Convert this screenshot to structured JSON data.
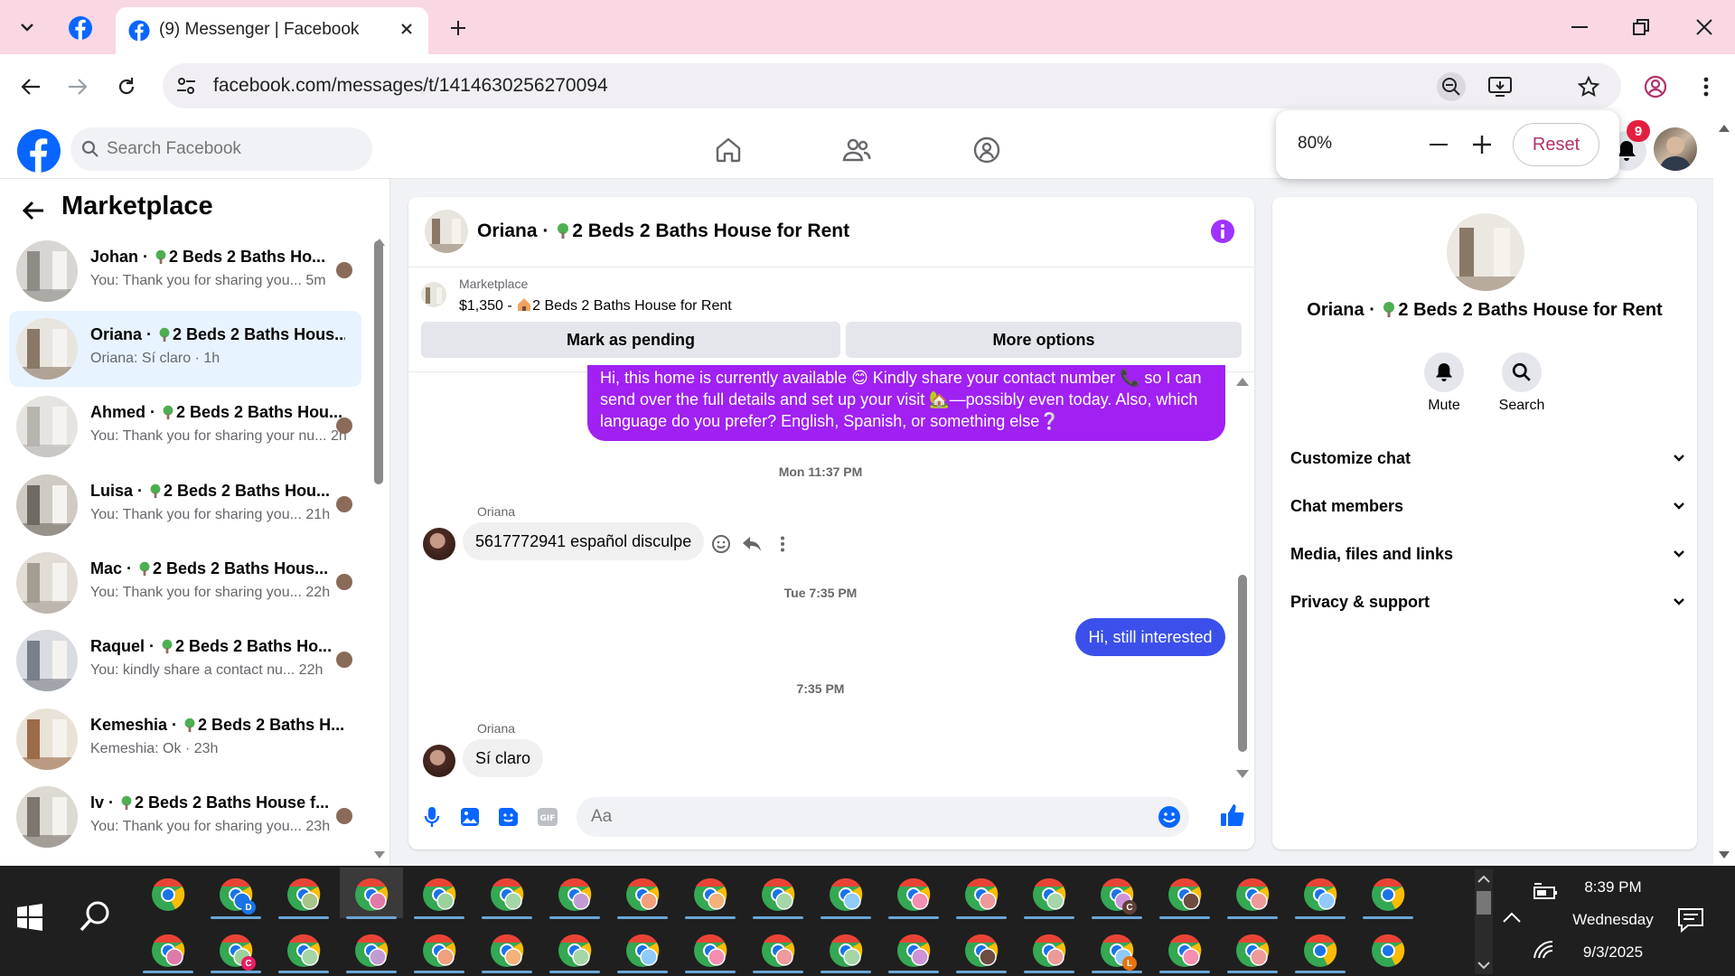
{
  "browser": {
    "tab_title": "(9) Messenger | Facebook",
    "url": "facebook.com/messages/t/1414630256270094",
    "zoom": {
      "percent": "80%",
      "reset_label": "Reset"
    }
  },
  "fb": {
    "search_placeholder": "Search Facebook",
    "notification_count": "9"
  },
  "sidebar": {
    "title": "Marketplace",
    "conversations": [
      {
        "name": "Johan · ",
        "listing": "2 Beds 2 Baths Ho...",
        "preview": "You: Thank you for sharing you...",
        "time": "5m"
      },
      {
        "name": "Oriana · ",
        "listing": "2 Beds 2 Baths Hous...",
        "preview": "Oriana: Sí claro · 1h",
        "time": ""
      },
      {
        "name": "Ahmed · ",
        "listing": "2 Beds 2 Baths Hou...",
        "preview": "You: Thank you for sharing your nu...",
        "time": "2h"
      },
      {
        "name": "Luisa · ",
        "listing": "2 Beds 2 Baths Hou...",
        "preview": "You: Thank you for sharing you...",
        "time": "21h"
      },
      {
        "name": "Mac · ",
        "listing": "2 Beds 2 Baths Hous...",
        "preview": "You: Thank you for sharing you...",
        "time": "22h"
      },
      {
        "name": "Raquel · ",
        "listing": "2 Beds 2 Baths Ho...",
        "preview": "You: kindly share a contact nu...",
        "time": "22h"
      },
      {
        "name": "Kemeshia · ",
        "listing": "2 Beds 2 Baths H...",
        "preview": "Kemeshia: Ok · 23h",
        "time": ""
      },
      {
        "name": "Iv · ",
        "listing": "2 Beds 2 Baths House f...",
        "preview": "You: Thank you for sharing you...",
        "time": "23h"
      }
    ]
  },
  "chat": {
    "title_name": "Oriana · ",
    "title_listing": "2 Beds 2 Baths House for Rent",
    "listing_label": "Marketplace",
    "listing_price": "$1,350 - ",
    "listing_name": "2 Beds 2 Baths House for Rent",
    "mark_pending": "Mark as pending",
    "more_options": "More options",
    "msg_out_1a": "Hi, this home is currently available 😊 Kindly share your contact number 📞 so I can",
    "msg_out_1b": "send over the full details and set up your visit 🏡—possibly even today. Also, which",
    "msg_out_1c": "language do you prefer? English, Spanish, or something else❔",
    "ts_1": "Mon 11:37 PM",
    "sender_1": "Oriana",
    "msg_in_1": "5617772941 español disculpe",
    "ts_2": "Tue 7:35 PM",
    "msg_out_2": "Hi, still interested",
    "ts_3": "7:35 PM",
    "sender_2": "Oriana",
    "msg_in_2": "Sí claro",
    "composer_placeholder": "Aa"
  },
  "right_panel": {
    "title_name": "Oriana · ",
    "title_listing": "2 Beds 2 Baths House for Rent",
    "mute": "Mute",
    "search": "Search",
    "sections": [
      "Customize chat",
      "Chat members",
      "Media, files and links",
      "Privacy & support"
    ]
  },
  "tray": {
    "time": "8:39 PM",
    "day": "Wednesday",
    "date": "9/3/2025"
  },
  "taskbar_chips": [
    "D",
    "C",
    "C",
    "L"
  ],
  "colors": {
    "fb_blue": "#0866ff",
    "messenger_purple": "#a021f2",
    "outgoing_blue": "#3b50ea",
    "tab_strip": "#f9d8e4"
  }
}
